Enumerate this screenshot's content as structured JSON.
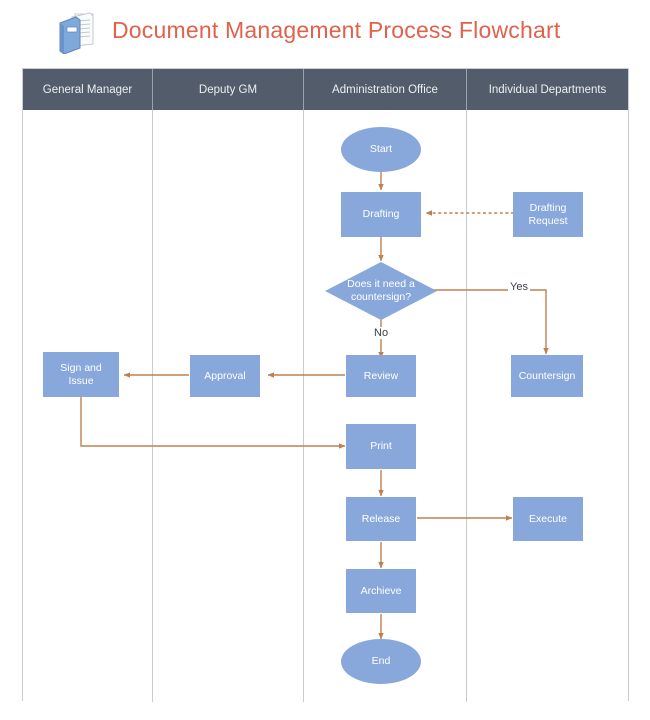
{
  "header": {
    "title": "Document Management Process Flowchart",
    "title_color": "#E0614C",
    "icon": "document-book-icon"
  },
  "swimlanes": {
    "header_bg": "#525C6B",
    "header_text_color": "#EDEFF2",
    "border_color": "#C9CCD3",
    "columns": [
      {
        "label": "General Manager"
      },
      {
        "label": "Deputy GM"
      },
      {
        "label": "Administration Office"
      },
      {
        "label": "Individual Departments"
      }
    ]
  },
  "style": {
    "node_fill": "#88A8DC",
    "node_text": "#FFFFFF",
    "connector": "#C08050",
    "label_text": "#3A3F48"
  },
  "chart_data": {
    "type": "diagram",
    "title": "Document Management Process Flowchart",
    "lanes": [
      "General Manager",
      "Deputy GM",
      "Administration Office",
      "Individual Departments"
    ],
    "nodes": [
      {
        "id": "start",
        "label": "Start",
        "shape": "terminator",
        "lane": "Administration Office"
      },
      {
        "id": "drafting",
        "label": "Drafting",
        "shape": "process",
        "lane": "Administration Office"
      },
      {
        "id": "drafting_request",
        "label": "Drafting\nRequest",
        "shape": "process",
        "lane": "Individual Departments"
      },
      {
        "id": "decision",
        "label": "Does it need a\ncountersign?",
        "shape": "decision",
        "lane": "Administration Office"
      },
      {
        "id": "countersign",
        "label": "Countersign",
        "shape": "process",
        "lane": "Individual Departments"
      },
      {
        "id": "review",
        "label": "Review",
        "shape": "process",
        "lane": "Administration Office"
      },
      {
        "id": "approval",
        "label": "Approval",
        "shape": "process",
        "lane": "Deputy GM"
      },
      {
        "id": "sign_issue",
        "label": "Sign and\nIssue",
        "shape": "process",
        "lane": "General Manager"
      },
      {
        "id": "print",
        "label": "Print",
        "shape": "process",
        "lane": "Administration Office"
      },
      {
        "id": "release",
        "label": "Release",
        "shape": "process",
        "lane": "Administration Office"
      },
      {
        "id": "execute",
        "label": "Execute",
        "shape": "process",
        "lane": "Individual Departments"
      },
      {
        "id": "archieve",
        "label": "Archieve",
        "shape": "process",
        "lane": "Administration Office"
      },
      {
        "id": "end",
        "label": "End",
        "shape": "terminator",
        "lane": "Administration Office"
      }
    ],
    "edges": [
      {
        "from": "start",
        "to": "drafting",
        "label": "",
        "style": "solid"
      },
      {
        "from": "drafting_request",
        "to": "drafting",
        "label": "",
        "style": "dashed"
      },
      {
        "from": "drafting",
        "to": "decision",
        "label": "",
        "style": "solid"
      },
      {
        "from": "decision",
        "to": "countersign",
        "label": "Yes",
        "style": "solid"
      },
      {
        "from": "decision",
        "to": "review",
        "label": "No",
        "style": "solid"
      },
      {
        "from": "review",
        "to": "approval",
        "label": "",
        "style": "solid"
      },
      {
        "from": "approval",
        "to": "sign_issue",
        "label": "",
        "style": "solid"
      },
      {
        "from": "sign_issue",
        "to": "print",
        "label": "",
        "style": "solid"
      },
      {
        "from": "print",
        "to": "release",
        "label": "",
        "style": "solid"
      },
      {
        "from": "release",
        "to": "execute",
        "label": "",
        "style": "solid"
      },
      {
        "from": "release",
        "to": "archieve",
        "label": "",
        "style": "solid"
      },
      {
        "from": "archieve",
        "to": "end",
        "label": "",
        "style": "solid"
      }
    ]
  },
  "nodes": {
    "start": {
      "label": "Start"
    },
    "drafting": {
      "label": "Drafting"
    },
    "drafting_request": {
      "line1": "Drafting",
      "line2": "Request"
    },
    "decision": {
      "line1": "Does it need a",
      "line2": "countersign?"
    },
    "countersign": {
      "label": "Countersign"
    },
    "review": {
      "label": "Review"
    },
    "approval": {
      "label": "Approval"
    },
    "sign_issue": {
      "line1": "Sign and",
      "line2": "Issue"
    },
    "print": {
      "label": "Print"
    },
    "release": {
      "label": "Release"
    },
    "execute": {
      "label": "Execute"
    },
    "archieve": {
      "label": "Archieve"
    },
    "end": {
      "label": "End"
    }
  },
  "edge_labels": {
    "yes": "Yes",
    "no": "No"
  }
}
